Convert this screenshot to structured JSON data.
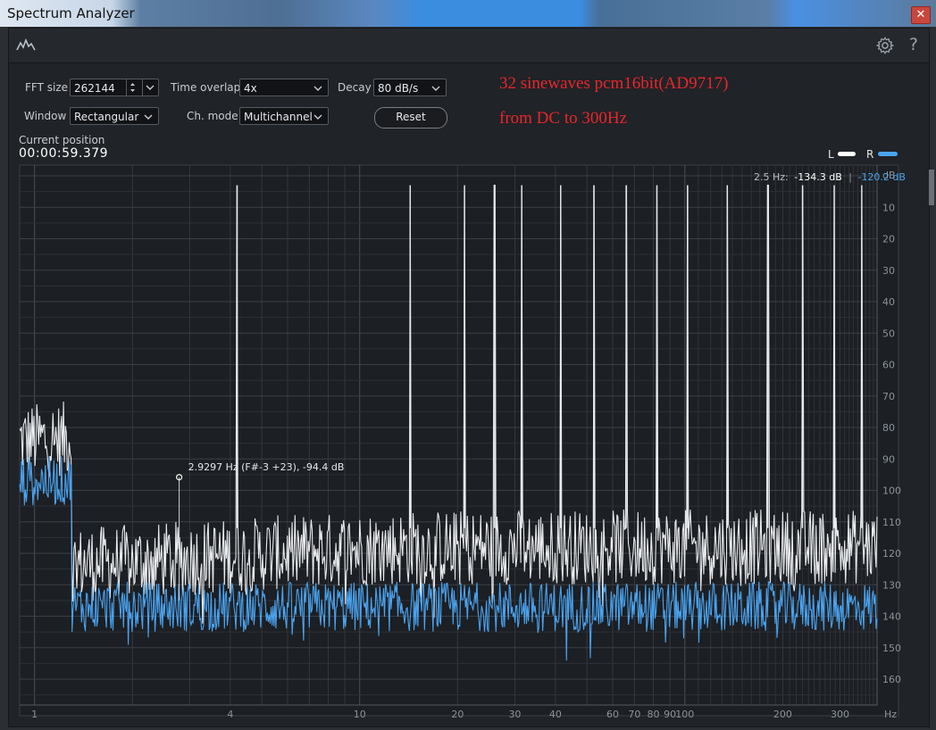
{
  "window": {
    "title": "Spectrum Analyzer",
    "close_glyph": "✕"
  },
  "toolbar": {
    "app_icon": "spectrum-icon",
    "settings_icon": "gear-icon",
    "help_glyph": "?"
  },
  "controls": {
    "fft_size_label": "FFT size",
    "fft_size_value": "262144",
    "time_overlap_label": "Time overlap",
    "time_overlap_value": "4x",
    "decay_label": "Decay",
    "decay_value": "80 dB/s",
    "window_label": "Window",
    "window_value": "Rectangular",
    "ch_mode_label": "Ch. mode",
    "ch_mode_value": "Multichannel",
    "reset_label": "Reset"
  },
  "annotations": {
    "line1": "32 sinewaves pcm16bit(AD9717)",
    "line2": "from DC to 300Hz",
    "color": "#e8262c"
  },
  "position": {
    "label": "Current position",
    "value": "00:00:59.379"
  },
  "legend": {
    "left_label": "L",
    "right_label": "R",
    "left_color": "#ffffff",
    "right_color": "#4aa3f0"
  },
  "readout": {
    "freq": "2.5 Hz:",
    "left_db": "-134.3 dB",
    "separator": "|",
    "right_db": "-120.2 dB"
  },
  "cursor": {
    "text": "2.9297 Hz (F#-3 +23), -94.4 dB",
    "freq_hz": 2.9297,
    "db": -94.4
  },
  "chart_data": {
    "type": "line",
    "x_scale": "log",
    "xlim_hz": [
      0.9,
      390
    ],
    "ylim_db": [
      -170,
      0
    ],
    "grid": true,
    "x_ticks": [
      {
        "v": 1,
        "label": "1"
      },
      {
        "v": 4,
        "label": "4"
      },
      {
        "v": 10,
        "label": "10"
      },
      {
        "v": 20,
        "label": "20"
      },
      {
        "v": 30,
        "label": "30"
      },
      {
        "v": 40,
        "label": "40"
      },
      {
        "v": 60,
        "label": "60"
      },
      {
        "v": 70,
        "label": "70"
      },
      {
        "v": 80,
        "label": "80"
      },
      {
        "v": 90,
        "label": "90"
      },
      {
        "v": 100,
        "label": "100"
      },
      {
        "v": 200,
        "label": "200"
      },
      {
        "v": 300,
        "label": "300"
      }
    ],
    "x_unit": "Hz",
    "y_ticks": [
      10,
      20,
      30,
      40,
      50,
      60,
      70,
      80,
      90,
      100,
      110,
      120,
      130,
      140,
      150,
      160
    ],
    "y_unit": "dB",
    "peaks_hz": [
      4.2,
      14.3,
      21,
      26,
      31.5,
      41.5,
      52.5,
      66,
      82,
      102,
      135,
      180,
      230,
      288,
      350
    ],
    "peak_db": -3,
    "series": [
      {
        "name": "L",
        "color": "#e8eaed",
        "noise_floor_db": -118,
        "noise_jitter_db": 12
      },
      {
        "name": "R",
        "color": "#4aa3f0",
        "noise_floor_db": -137,
        "noise_jitter_db": 8
      }
    ]
  }
}
